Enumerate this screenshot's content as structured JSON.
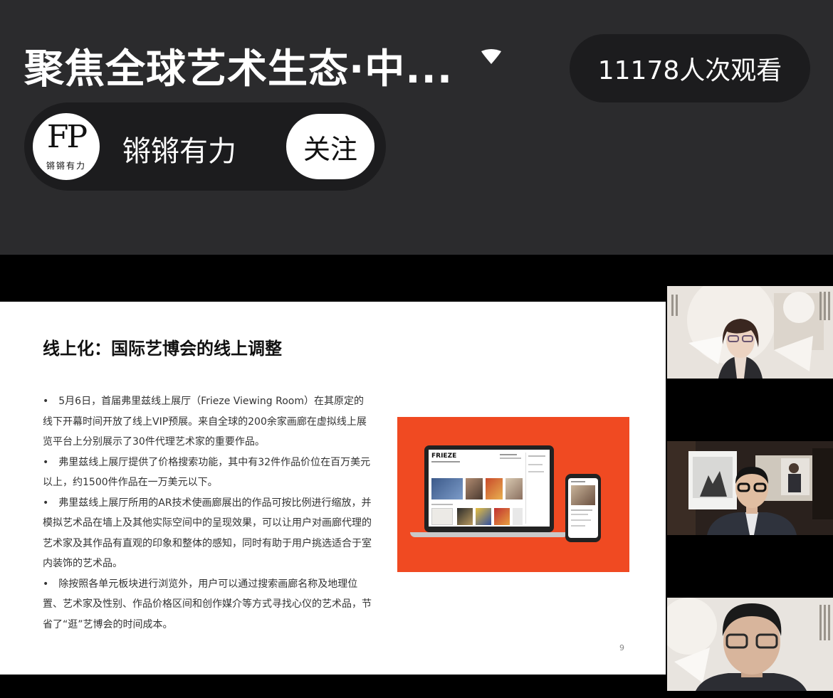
{
  "header": {
    "title": "聚焦全球艺术生态·中...",
    "viewers": "11178人次观看"
  },
  "author": {
    "avatar_logo": "FP",
    "avatar_caption": "锵锵有力",
    "name": "锵锵有力",
    "follow_label": "关注"
  },
  "slide": {
    "title": "线上化：国际艺博会的线上调整",
    "bullets": [
      "•　5月6日，首届弗里兹线上展厅（Frieze Viewing Room）在其原定的线下开幕时间开放了线上VIP预展。来自全球的200余家画廊在虚拟线上展览平台上分别展示了30件代理艺术家的重要作品。",
      "•　弗里兹线上展厅提供了价格搜索功能，其中有32件作品价位在百万美元以上，约1500件作品在一万美元以下。",
      "•　弗里兹线上展厅所用的AR技术使画廊展出的作品可按比例进行缩放，并模拟艺术品在墙上及其他实际空间中的呈现效果，可以让用户对画廊代理的艺术家及其作品有直观的印象和整体的感知，同时有助于用户挑选适合于室内装饰的艺术品。",
      "•　除按照各单元板块进行浏览外，用户可以通过搜索画廊名称及地理位置、艺术家及性别、作品价格区间和创作媒介等方式寻找心仪的艺术品，节省了“逛”艺博会的时间成本。"
    ],
    "image_brand": "FRIEZE",
    "page_number": "9"
  },
  "colors": {
    "background": "#2b2b2d",
    "pill": "#1c1c1e",
    "slide_accent": "#f04a22"
  },
  "icons": {
    "title_dropdown": "caret-down-icon"
  }
}
